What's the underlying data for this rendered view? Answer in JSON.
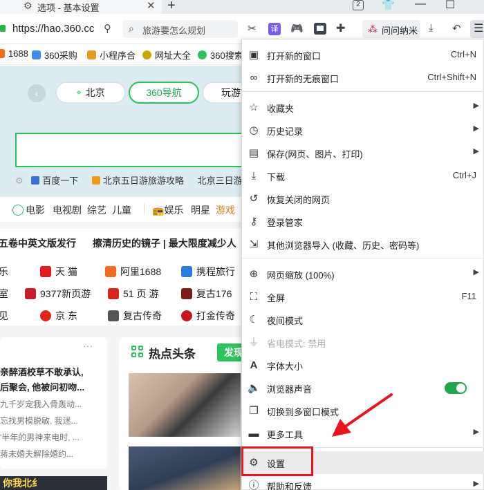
{
  "tab": {
    "title": "选项 - 基本设置",
    "close": "✕",
    "new_tab": "+",
    "count": "2"
  },
  "window": {
    "minimize": "—",
    "maximize": "☐"
  },
  "addressbar": {
    "url": "https://hao.360.cc",
    "search_query": "旅游要怎么规划",
    "extension_yi": "译",
    "wenwen_label": "问问纳米"
  },
  "bookmarks": [
    {
      "label": "1688",
      "icon": "orange-square-icon",
      "color": "#f26b1d"
    },
    {
      "label": "360采购",
      "icon": "360-icon",
      "color": "#3b8df0"
    },
    {
      "label": "小程序合",
      "icon": "cube-icon",
      "color": "#e89b1a"
    },
    {
      "label": "网址大全",
      "icon": "star-circle-icon",
      "color": "#c9a800"
    },
    {
      "label": "360搜索",
      "icon": "search-circle-icon",
      "color": "#2cc35c"
    }
  ],
  "hero": {
    "tabs": [
      "北京",
      "360导航",
      "玩游"
    ],
    "hot_searches": [
      "百度一下",
      "北京五日游旅游攻略",
      "北京三日游"
    ]
  },
  "nav_row": [
    "电影",
    "电视剧",
    "综艺",
    "儿童",
    "娱乐",
    "明星",
    "游戏"
  ],
  "ticker": [
    "五卷中英文版发行",
    "擦清历史的镜子 | 最大限度减少人"
  ],
  "sites": [
    [
      "乐",
      "天 猫",
      "阿里1688",
      "携程旅行"
    ],
    [
      "室",
      "9377新页游",
      "51 页 游",
      "复古176"
    ],
    [
      "见",
      "京 东",
      "复古传奇",
      "打金传奇"
    ]
  ],
  "news": {
    "headlines": [
      "亲醉酒校草不敢承认,",
      "后聚会, 他被问初吻..."
    ],
    "snippets": [
      "九千岁宠我入骨轰动...",
      "忘找男模脱敏, 我迷...",
      "'半年的男神来电时, ...",
      "蒋未婚夫解除婚约..."
    ],
    "banner": "你我北纟"
  },
  "hotnews": {
    "title": "热点头条",
    "publish": "发现"
  },
  "menu": {
    "items": [
      {
        "label": "打开新的窗口",
        "shortcut": "Ctrl+N",
        "icon": "window-icon"
      },
      {
        "label": "打开新的无痕窗口",
        "shortcut": "Ctrl+Shift+N",
        "icon": "incognito-icon"
      },
      {
        "label": "收藏夹",
        "icon": "star-icon",
        "submenu": true
      },
      {
        "label": "历史记录",
        "icon": "clock-icon",
        "submenu": true
      },
      {
        "label": "保存(网页、图片、打印)",
        "icon": "save-icon",
        "submenu": true
      },
      {
        "label": "下载",
        "shortcut": "Ctrl+J",
        "icon": "download-icon"
      },
      {
        "label": "恢复关闭的网页",
        "icon": "restore-icon"
      },
      {
        "label": "登录管家",
        "icon": "key-icon"
      },
      {
        "label": "其他浏览器导入 (收藏、历史、密码等)",
        "icon": "import-icon"
      },
      {
        "label": "网页缩放 (100%)",
        "icon": "zoom-icon",
        "submenu": true
      },
      {
        "label": "全屏",
        "shortcut": "F11",
        "icon": "fullscreen-icon"
      },
      {
        "label": "夜间模式",
        "icon": "moon-icon"
      },
      {
        "label": "省电模式: 禁用",
        "icon": "plug-icon",
        "disabled": true
      },
      {
        "label": "字体大小",
        "icon": "font-icon"
      },
      {
        "label": "浏览器声音",
        "icon": "speaker-icon",
        "toggle": true
      },
      {
        "label": "切换到多窗口模式",
        "icon": "multiwindow-icon"
      },
      {
        "label": "更多工具",
        "icon": "toolbox-icon",
        "submenu": true
      },
      {
        "label": "设置",
        "icon": "gear-icon",
        "hover": true
      },
      {
        "label": "帮助和反馈",
        "icon": "help-icon",
        "submenu": true
      }
    ],
    "sound_enabled": true
  },
  "colors": {
    "accent": "#2cc35c",
    "annotation": "#e8161c"
  }
}
